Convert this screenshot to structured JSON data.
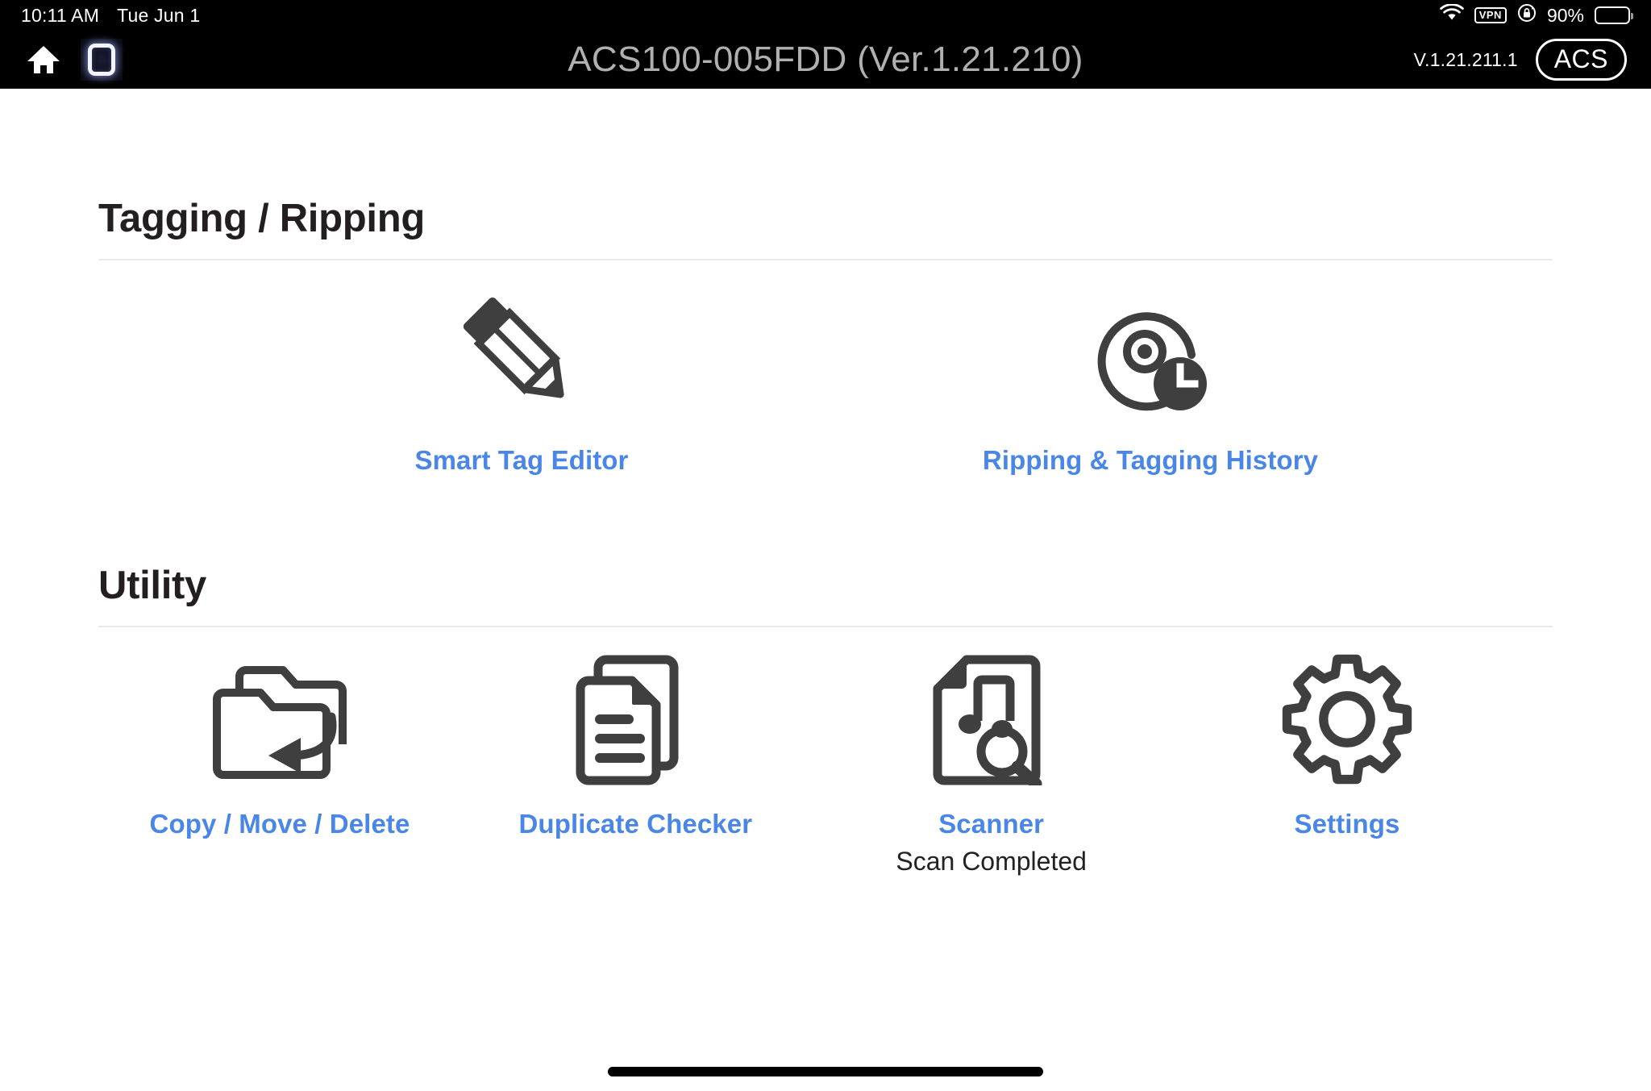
{
  "statusbar": {
    "time": "10:11 AM",
    "date": "Tue Jun 1",
    "wifi_icon": "wifi-icon",
    "vpn_label": "VPN",
    "rotation_lock_icon": "rotation-lock-icon",
    "battery_percent": "90%",
    "battery_level": 90
  },
  "appbar": {
    "home_icon": "home-icon",
    "app_switch_icon": "rounded-square-icon",
    "title": "ACS100-005FDD (Ver.1.21.210)",
    "version": "V.1.21.211.1",
    "account_label": "ACS"
  },
  "colors": {
    "link_blue": "#4a86e8",
    "icon_dark": "#3f3f3f",
    "heading": "#231f20",
    "status_text": "#222222",
    "rule": "#e9e9e9",
    "appbar_bg": "#000000",
    "title_gray": "#b0b0b0"
  },
  "sections": [
    {
      "id": "tagging-ripping",
      "title": "Tagging / Ripping",
      "tiles": [
        {
          "id": "smart-tag-editor",
          "label": "Smart Tag Editor",
          "icon": "pencil-icon",
          "status": ""
        },
        {
          "id": "ripping-tagging-history",
          "label": "Ripping & Tagging History",
          "icon": "disc-clock-icon",
          "status": ""
        }
      ]
    },
    {
      "id": "utility",
      "title": "Utility",
      "tiles": [
        {
          "id": "copy-move-delete",
          "label": "Copy / Move / Delete",
          "icon": "folder-arrow-icon",
          "status": ""
        },
        {
          "id": "duplicate-checker",
          "label": "Duplicate Checker",
          "icon": "documents-icon",
          "status": ""
        },
        {
          "id": "scanner",
          "label": "Scanner",
          "icon": "music-file-search-icon",
          "status": "Scan Completed"
        },
        {
          "id": "settings",
          "label": "Settings",
          "icon": "gear-icon",
          "status": ""
        }
      ]
    }
  ]
}
